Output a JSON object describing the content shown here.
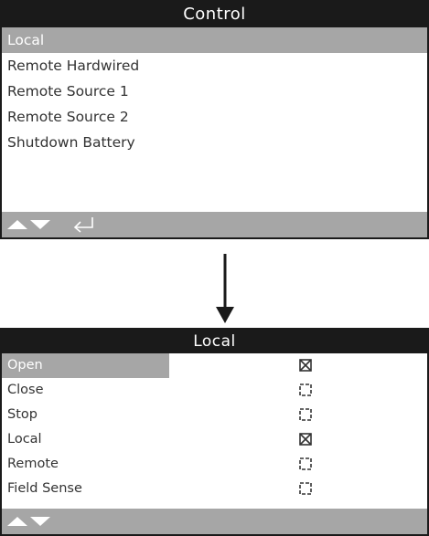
{
  "control_screen": {
    "title": "Control",
    "items": [
      {
        "label": "Local",
        "selected": true
      },
      {
        "label": "Remote Hardwired",
        "selected": false
      },
      {
        "label": "Remote Source 1",
        "selected": false
      },
      {
        "label": "Remote Source 2",
        "selected": false
      },
      {
        "label": "Shutdown Battery",
        "selected": false
      }
    ],
    "footer_icons": [
      "up-arrow-icon",
      "down-arrow-icon",
      "enter-return-icon"
    ]
  },
  "transition_icon": "down-arrow-icon",
  "local_screen": {
    "title": "Local",
    "items": [
      {
        "label": "Open",
        "checked": true,
        "selected": true
      },
      {
        "label": "Close",
        "checked": false,
        "selected": false
      },
      {
        "label": "Stop",
        "checked": false,
        "selected": false
      },
      {
        "label": "Local",
        "checked": true,
        "selected": false
      },
      {
        "label": "Remote",
        "checked": false,
        "selected": false
      },
      {
        "label": "Field Sense",
        "checked": false,
        "selected": false
      }
    ],
    "footer_icons": [
      "up-arrow-icon",
      "down-arrow-icon"
    ]
  },
  "colors": {
    "title_bar": "#1a1a1a",
    "highlight": "#a6a6a6",
    "text": "#333333"
  }
}
